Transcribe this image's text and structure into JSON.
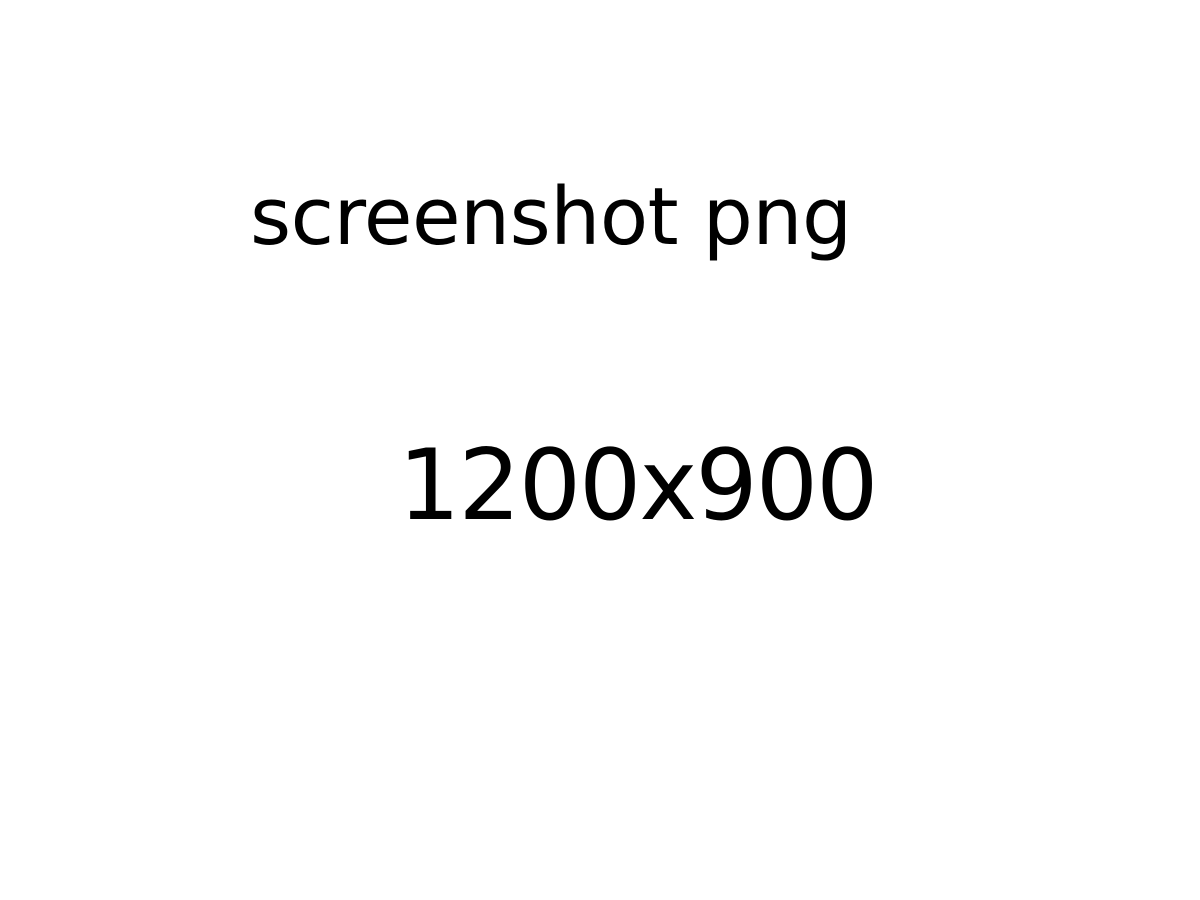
{
  "placeholder": {
    "line_1": "screenshot png",
    "line_2": "1200x900"
  },
  "colors": {
    "background": "#ffffff",
    "text": "#000000"
  }
}
